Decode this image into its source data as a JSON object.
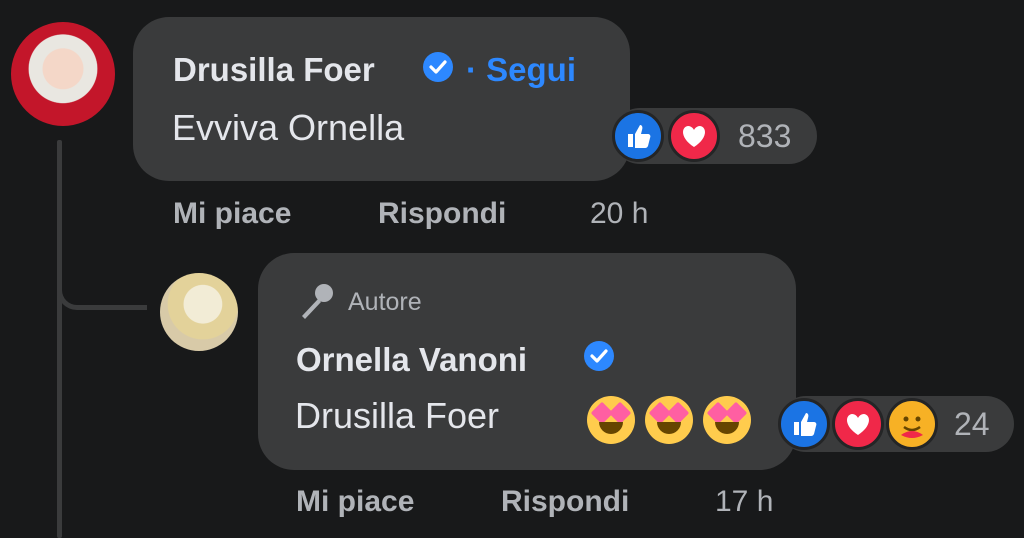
{
  "comments": [
    {
      "author": "Drusilla Foer",
      "follow": "· Segui",
      "text": "Evviva Ornella",
      "reaction_count": "833",
      "actions": {
        "like": "Mi piace",
        "reply": "Rispondi"
      },
      "time": "20 h",
      "reactions": [
        "like",
        "love"
      ]
    },
    {
      "badge": "Autore",
      "author": "Ornella Vanoni",
      "text": "Drusilla Foer",
      "emojis": [
        "star-struck",
        "star-struck",
        "star-struck"
      ],
      "reaction_count": "24",
      "actions": {
        "like": "Mi piace",
        "reply": "Rispondi"
      },
      "time": "17 h",
      "reactions": [
        "like",
        "love",
        "care"
      ]
    }
  ],
  "colors": {
    "background": "#18191a",
    "bubble": "#3a3b3c",
    "link": "#2d88ff",
    "secondary_text": "#b0b3b8"
  }
}
